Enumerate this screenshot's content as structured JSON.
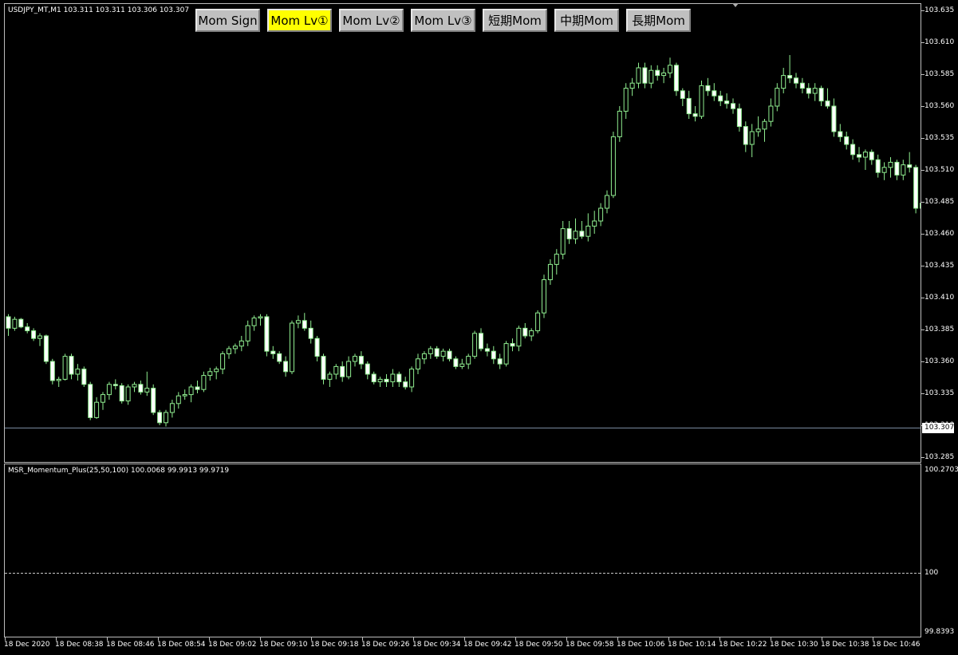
{
  "chart_header": {
    "symbol_info": "USDJPY_MT,M1  103.311 103.311 103.306 103.307"
  },
  "buttons": [
    {
      "label": "Mom Sign",
      "active": false
    },
    {
      "label": "Mom Lv①",
      "active": true
    },
    {
      "label": "Mom Lv②",
      "active": false
    },
    {
      "label": "Mom Lv③",
      "active": false
    },
    {
      "label": "短期Mom",
      "active": false
    },
    {
      "label": "中期Mom",
      "active": false
    },
    {
      "label": "長期Mom",
      "active": false
    }
  ],
  "price_axis": [
    "103.635",
    "103.610",
    "103.585",
    "103.560",
    "103.535",
    "103.510",
    "103.485",
    "103.460",
    "103.435",
    "103.410",
    "103.385",
    "103.360",
    "103.335",
    "103.310",
    "103.285"
  ],
  "current_price": "103.307",
  "indicator": {
    "info": "MSR_Momentum_Plus(25,50,100) 100.0068 99.9913 99.9719",
    "scale_top": "100.2703",
    "level": "100",
    "scale_bottom": "99.8393"
  },
  "time_axis": [
    "18 Dec 2020",
    "18 Dec 08:38",
    "18 Dec 08:46",
    "18 Dec 08:54",
    "18 Dec 09:02",
    "18 Dec 09:10",
    "18 Dec 09:18",
    "18 Dec 09:26",
    "18 Dec 09:34",
    "18 Dec 09:42",
    "18 Dec 09:50",
    "18 Dec 09:58",
    "18 Dec 10:06",
    "18 Dec 10:14",
    "18 Dec 10:22",
    "18 Dec 10:30",
    "18 Dec 10:38",
    "18 Dec 10:46"
  ],
  "colors": {
    "background": "#000000",
    "candle": "#90ee90",
    "active_button": "#ffff00",
    "button": "#c0c0c0"
  },
  "chart_data": {
    "type": "candlestick",
    "symbol": "USDJPY_MT",
    "timeframe": "M1",
    "ylim": [
      103.285,
      103.64
    ],
    "series": [
      {
        "o": 103.395,
        "h": 103.397,
        "l": 103.38,
        "c": 103.386
      },
      {
        "o": 103.386,
        "h": 103.395,
        "l": 103.384,
        "c": 103.393
      },
      {
        "o": 103.393,
        "h": 103.394,
        "l": 103.386,
        "c": 103.387
      },
      {
        "o": 103.387,
        "h": 103.39,
        "l": 103.382,
        "c": 103.384
      },
      {
        "o": 103.384,
        "h": 103.386,
        "l": 103.376,
        "c": 103.378
      },
      {
        "o": 103.378,
        "h": 103.382,
        "l": 103.372,
        "c": 103.38
      },
      {
        "o": 103.38,
        "h": 103.381,
        "l": 103.358,
        "c": 103.36
      },
      {
        "o": 103.36,
        "h": 103.362,
        "l": 103.342,
        "c": 103.345
      },
      {
        "o": 103.345,
        "h": 103.348,
        "l": 103.34,
        "c": 103.346
      },
      {
        "o": 103.346,
        "h": 103.366,
        "l": 103.345,
        "c": 103.364
      },
      {
        "o": 103.364,
        "h": 103.366,
        "l": 103.346,
        "c": 103.35
      },
      {
        "o": 103.35,
        "h": 103.358,
        "l": 103.345,
        "c": 103.354
      },
      {
        "o": 103.354,
        "h": 103.356,
        "l": 103.34,
        "c": 103.342
      },
      {
        "o": 103.342,
        "h": 103.344,
        "l": 103.314,
        "c": 103.316
      },
      {
        "o": 103.316,
        "h": 103.332,
        "l": 103.315,
        "c": 103.328
      },
      {
        "o": 103.328,
        "h": 103.336,
        "l": 103.322,
        "c": 103.334
      },
      {
        "o": 103.334,
        "h": 103.344,
        "l": 103.33,
        "c": 103.342
      },
      {
        "o": 103.342,
        "h": 103.346,
        "l": 103.338,
        "c": 103.341
      },
      {
        "o": 103.341,
        "h": 103.343,
        "l": 103.327,
        "c": 103.329
      },
      {
        "o": 103.329,
        "h": 103.342,
        "l": 103.326,
        "c": 103.34
      },
      {
        "o": 103.34,
        "h": 103.344,
        "l": 103.336,
        "c": 103.342
      },
      {
        "o": 103.342,
        "h": 103.345,
        "l": 103.334,
        "c": 103.336
      },
      {
        "o": 103.336,
        "h": 103.352,
        "l": 103.333,
        "c": 103.339
      },
      {
        "o": 103.339,
        "h": 103.342,
        "l": 103.318,
        "c": 103.32
      },
      {
        "o": 103.32,
        "h": 103.322,
        "l": 103.31,
        "c": 103.312
      },
      {
        "o": 103.312,
        "h": 103.322,
        "l": 103.309,
        "c": 103.32
      },
      {
        "o": 103.32,
        "h": 103.33,
        "l": 103.316,
        "c": 103.327
      },
      {
        "o": 103.327,
        "h": 103.336,
        "l": 103.323,
        "c": 103.333
      },
      {
        "o": 103.333,
        "h": 103.338,
        "l": 103.33,
        "c": 103.334
      },
      {
        "o": 103.334,
        "h": 103.342,
        "l": 103.328,
        "c": 103.34
      },
      {
        "o": 103.34,
        "h": 103.345,
        "l": 103.335,
        "c": 103.338
      },
      {
        "o": 103.338,
        "h": 103.352,
        "l": 103.336,
        "c": 103.349
      },
      {
        "o": 103.349,
        "h": 103.355,
        "l": 103.345,
        "c": 103.352
      },
      {
        "o": 103.352,
        "h": 103.356,
        "l": 103.346,
        "c": 103.354
      },
      {
        "o": 103.354,
        "h": 103.368,
        "l": 103.35,
        "c": 103.366
      },
      {
        "o": 103.366,
        "h": 103.372,
        "l": 103.362,
        "c": 103.37
      },
      {
        "o": 103.37,
        "h": 103.374,
        "l": 103.366,
        "c": 103.372
      },
      {
        "o": 103.372,
        "h": 103.38,
        "l": 103.368,
        "c": 103.376
      },
      {
        "o": 103.376,
        "h": 103.392,
        "l": 103.372,
        "c": 103.388
      },
      {
        "o": 103.388,
        "h": 103.396,
        "l": 103.384,
        "c": 103.394
      },
      {
        "o": 103.394,
        "h": 103.397,
        "l": 103.388,
        "c": 103.395
      },
      {
        "o": 103.395,
        "h": 103.397,
        "l": 103.364,
        "c": 103.368
      },
      {
        "o": 103.368,
        "h": 103.372,
        "l": 103.362,
        "c": 103.366
      },
      {
        "o": 103.366,
        "h": 103.368,
        "l": 103.358,
        "c": 103.36
      },
      {
        "o": 103.36,
        "h": 103.364,
        "l": 103.348,
        "c": 103.352
      },
      {
        "o": 103.352,
        "h": 103.392,
        "l": 103.35,
        "c": 103.39
      },
      {
        "o": 103.39,
        "h": 103.396,
        "l": 103.386,
        "c": 103.392
      },
      {
        "o": 103.392,
        "h": 103.398,
        "l": 103.384,
        "c": 103.386
      },
      {
        "o": 103.386,
        "h": 103.392,
        "l": 103.374,
        "c": 103.378
      },
      {
        "o": 103.378,
        "h": 103.38,
        "l": 103.36,
        "c": 103.364
      },
      {
        "o": 103.364,
        "h": 103.366,
        "l": 103.342,
        "c": 103.346
      },
      {
        "o": 103.346,
        "h": 103.352,
        "l": 103.34,
        "c": 103.35
      },
      {
        "o": 103.35,
        "h": 103.358,
        "l": 103.346,
        "c": 103.356
      },
      {
        "o": 103.356,
        "h": 103.36,
        "l": 103.344,
        "c": 103.348
      },
      {
        "o": 103.348,
        "h": 103.364,
        "l": 103.346,
        "c": 103.36
      },
      {
        "o": 103.36,
        "h": 103.366,
        "l": 103.356,
        "c": 103.364
      },
      {
        "o": 103.364,
        "h": 103.368,
        "l": 103.354,
        "c": 103.358
      },
      {
        "o": 103.358,
        "h": 103.36,
        "l": 103.346,
        "c": 103.35
      },
      {
        "o": 103.35,
        "h": 103.352,
        "l": 103.342,
        "c": 103.344
      },
      {
        "o": 103.344,
        "h": 103.348,
        "l": 103.34,
        "c": 103.346
      },
      {
        "o": 103.346,
        "h": 103.35,
        "l": 103.34,
        "c": 103.344
      },
      {
        "o": 103.344,
        "h": 103.354,
        "l": 103.34,
        "c": 103.35
      },
      {
        "o": 103.35,
        "h": 103.352,
        "l": 103.34,
        "c": 103.344
      },
      {
        "o": 103.344,
        "h": 103.348,
        "l": 103.338,
        "c": 103.34
      },
      {
        "o": 103.34,
        "h": 103.356,
        "l": 103.336,
        "c": 103.354
      },
      {
        "o": 103.354,
        "h": 103.366,
        "l": 103.35,
        "c": 103.362
      },
      {
        "o": 103.362,
        "h": 103.368,
        "l": 103.358,
        "c": 103.366
      },
      {
        "o": 103.366,
        "h": 103.372,
        "l": 103.362,
        "c": 103.37
      },
      {
        "o": 103.37,
        "h": 103.372,
        "l": 103.362,
        "c": 103.364
      },
      {
        "o": 103.364,
        "h": 103.37,
        "l": 103.36,
        "c": 103.368
      },
      {
        "o": 103.368,
        "h": 103.37,
        "l": 103.36,
        "c": 103.362
      },
      {
        "o": 103.362,
        "h": 103.364,
        "l": 103.354,
        "c": 103.356
      },
      {
        "o": 103.356,
        "h": 103.362,
        "l": 103.354,
        "c": 103.358
      },
      {
        "o": 103.358,
        "h": 103.366,
        "l": 103.354,
        "c": 103.364
      },
      {
        "o": 103.364,
        "h": 103.384,
        "l": 103.362,
        "c": 103.382
      },
      {
        "o": 103.382,
        "h": 103.386,
        "l": 103.368,
        "c": 103.37
      },
      {
        "o": 103.37,
        "h": 103.374,
        "l": 103.364,
        "c": 103.368
      },
      {
        "o": 103.368,
        "h": 103.372,
        "l": 103.358,
        "c": 103.362
      },
      {
        "o": 103.362,
        "h": 103.366,
        "l": 103.354,
        "c": 103.358
      },
      {
        "o": 103.358,
        "h": 103.376,
        "l": 103.356,
        "c": 103.374
      },
      {
        "o": 103.374,
        "h": 103.378,
        "l": 103.368,
        "c": 103.372
      },
      {
        "o": 103.372,
        "h": 103.388,
        "l": 103.368,
        "c": 103.386
      },
      {
        "o": 103.386,
        "h": 103.39,
        "l": 103.378,
        "c": 103.38
      },
      {
        "o": 103.38,
        "h": 103.386,
        "l": 103.376,
        "c": 103.384
      },
      {
        "o": 103.384,
        "h": 103.4,
        "l": 103.382,
        "c": 103.398
      },
      {
        "o": 103.398,
        "h": 103.428,
        "l": 103.394,
        "c": 103.424
      },
      {
        "o": 103.424,
        "h": 103.44,
        "l": 103.42,
        "c": 103.436
      },
      {
        "o": 103.436,
        "h": 103.448,
        "l": 103.428,
        "c": 103.444
      },
      {
        "o": 103.444,
        "h": 103.47,
        "l": 103.44,
        "c": 103.464
      },
      {
        "o": 103.464,
        "h": 103.47,
        "l": 103.452,
        "c": 103.456
      },
      {
        "o": 103.456,
        "h": 103.472,
        "l": 103.452,
        "c": 103.462
      },
      {
        "o": 103.462,
        "h": 103.47,
        "l": 103.456,
        "c": 103.458
      },
      {
        "o": 103.458,
        "h": 103.476,
        "l": 103.454,
        "c": 103.466
      },
      {
        "o": 103.466,
        "h": 103.478,
        "l": 103.46,
        "c": 103.47
      },
      {
        "o": 103.47,
        "h": 103.484,
        "l": 103.466,
        "c": 103.48
      },
      {
        "o": 103.48,
        "h": 103.494,
        "l": 103.476,
        "c": 103.49
      },
      {
        "o": 103.49,
        "h": 103.54,
        "l": 103.488,
        "c": 103.536
      },
      {
        "o": 103.536,
        "h": 103.56,
        "l": 103.532,
        "c": 103.556
      },
      {
        "o": 103.556,
        "h": 103.578,
        "l": 103.55,
        "c": 103.574
      },
      {
        "o": 103.574,
        "h": 103.582,
        "l": 103.568,
        "c": 103.578
      },
      {
        "o": 103.578,
        "h": 103.594,
        "l": 103.574,
        "c": 103.59
      },
      {
        "o": 103.59,
        "h": 103.594,
        "l": 103.574,
        "c": 103.578
      },
      {
        "o": 103.578,
        "h": 103.592,
        "l": 103.574,
        "c": 103.588
      },
      {
        "o": 103.588,
        "h": 103.592,
        "l": 103.58,
        "c": 103.584
      },
      {
        "o": 103.584,
        "h": 103.59,
        "l": 103.578,
        "c": 103.586
      },
      {
        "o": 103.586,
        "h": 103.598,
        "l": 103.582,
        "c": 103.592
      },
      {
        "o": 103.592,
        "h": 103.594,
        "l": 103.568,
        "c": 103.572
      },
      {
        "o": 103.572,
        "h": 103.574,
        "l": 103.56,
        "c": 103.566
      },
      {
        "o": 103.566,
        "h": 103.572,
        "l": 103.55,
        "c": 103.554
      },
      {
        "o": 103.554,
        "h": 103.56,
        "l": 103.548,
        "c": 103.552
      },
      {
        "o": 103.552,
        "h": 103.58,
        "l": 103.55,
        "c": 103.576
      },
      {
        "o": 103.576,
        "h": 103.582,
        "l": 103.568,
        "c": 103.572
      },
      {
        "o": 103.572,
        "h": 103.578,
        "l": 103.564,
        "c": 103.568
      },
      {
        "o": 103.568,
        "h": 103.572,
        "l": 103.56,
        "c": 103.564
      },
      {
        "o": 103.564,
        "h": 103.57,
        "l": 103.558,
        "c": 103.562
      },
      {
        "o": 103.562,
        "h": 103.566,
        "l": 103.554,
        "c": 103.558
      },
      {
        "o": 103.558,
        "h": 103.562,
        "l": 103.54,
        "c": 103.544
      },
      {
        "o": 103.544,
        "h": 103.548,
        "l": 103.524,
        "c": 103.53
      },
      {
        "o": 103.53,
        "h": 103.546,
        "l": 103.52,
        "c": 103.54
      },
      {
        "o": 103.54,
        "h": 103.552,
        "l": 103.536,
        "c": 103.542
      },
      {
        "o": 103.542,
        "h": 103.55,
        "l": 103.532,
        "c": 103.548
      },
      {
        "o": 103.548,
        "h": 103.566,
        "l": 103.544,
        "c": 103.56
      },
      {
        "o": 103.56,
        "h": 103.578,
        "l": 103.556,
        "c": 103.574
      },
      {
        "o": 103.574,
        "h": 103.59,
        "l": 103.57,
        "c": 103.584
      },
      {
        "o": 103.584,
        "h": 103.6,
        "l": 103.578,
        "c": 103.582
      },
      {
        "o": 103.582,
        "h": 103.586,
        "l": 103.574,
        "c": 103.578
      },
      {
        "o": 103.578,
        "h": 103.582,
        "l": 103.57,
        "c": 103.574
      },
      {
        "o": 103.574,
        "h": 103.578,
        "l": 103.566,
        "c": 103.57
      },
      {
        "o": 103.57,
        "h": 103.578,
        "l": 103.564,
        "c": 103.574
      },
      {
        "o": 103.574,
        "h": 103.576,
        "l": 103.56,
        "c": 103.564
      },
      {
        "o": 103.564,
        "h": 103.574,
        "l": 103.558,
        "c": 103.56
      },
      {
        "o": 103.56,
        "h": 103.566,
        "l": 103.536,
        "c": 103.54
      },
      {
        "o": 103.54,
        "h": 103.546,
        "l": 103.532,
        "c": 103.536
      },
      {
        "o": 103.536,
        "h": 103.54,
        "l": 103.526,
        "c": 103.53
      },
      {
        "o": 103.53,
        "h": 103.534,
        "l": 103.518,
        "c": 103.522
      },
      {
        "o": 103.522,
        "h": 103.528,
        "l": 103.516,
        "c": 103.52
      },
      {
        "o": 103.52,
        "h": 103.526,
        "l": 103.51,
        "c": 103.524
      },
      {
        "o": 103.524,
        "h": 103.526,
        "l": 103.514,
        "c": 103.518
      },
      {
        "o": 103.518,
        "h": 103.522,
        "l": 103.504,
        "c": 103.508
      },
      {
        "o": 103.508,
        "h": 103.516,
        "l": 103.502,
        "c": 103.512
      },
      {
        "o": 103.512,
        "h": 103.52,
        "l": 103.504,
        "c": 103.516
      },
      {
        "o": 103.516,
        "h": 103.518,
        "l": 103.502,
        "c": 103.506
      },
      {
        "o": 103.506,
        "h": 103.518,
        "l": 103.502,
        "c": 103.514
      },
      {
        "o": 103.514,
        "h": 103.524,
        "l": 103.508,
        "c": 103.512
      },
      {
        "o": 103.512,
        "h": 103.514,
        "l": 103.476,
        "c": 103.48
      },
      {
        "o": 103.48,
        "h": 103.49,
        "l": 103.476,
        "c": 103.484
      },
      {
        "o": 103.484,
        "h": 103.488,
        "l": 103.474,
        "c": 103.478
      }
    ]
  }
}
